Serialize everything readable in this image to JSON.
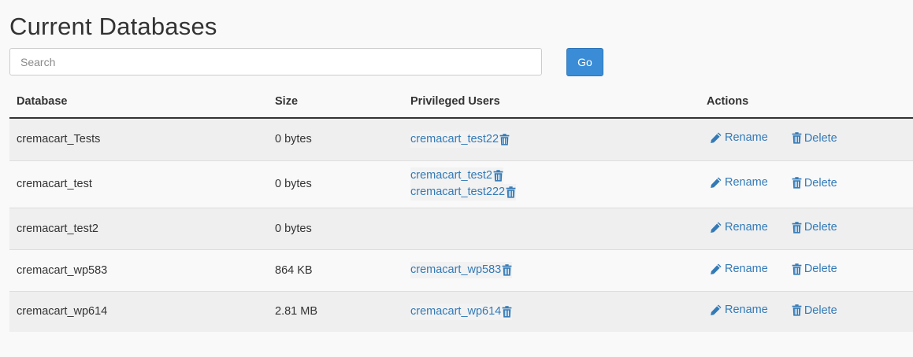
{
  "page": {
    "title": "Current Databases"
  },
  "search": {
    "placeholder": "Search",
    "value": "",
    "go_label": "Go"
  },
  "colors": {
    "link": "#337ab7",
    "go_button": "#3a8cd6",
    "row_odd": "#efefef",
    "row_even": "#f9f9f9"
  },
  "table": {
    "headers": {
      "database": "Database",
      "size": "Size",
      "users": "Privileged Users",
      "actions": "Actions"
    },
    "action_labels": {
      "rename": "Rename",
      "delete": "Delete"
    },
    "action_icons": {
      "rename": "pencil-icon",
      "delete": "trash-icon"
    },
    "rows": [
      {
        "database": "cremacart_Tests",
        "size": "0 bytes",
        "users": [
          "cremacart_test22"
        ]
      },
      {
        "database": "cremacart_test",
        "size": "0 bytes",
        "users": [
          "cremacart_test2",
          "cremacart_test222"
        ]
      },
      {
        "database": "cremacart_test2",
        "size": "0 bytes",
        "users": []
      },
      {
        "database": "cremacart_wp583",
        "size": "864 KB",
        "users": [
          "cremacart_wp583"
        ]
      },
      {
        "database": "cremacart_wp614",
        "size": "2.81 MB",
        "users": [
          "cremacart_wp614"
        ]
      }
    ]
  }
}
